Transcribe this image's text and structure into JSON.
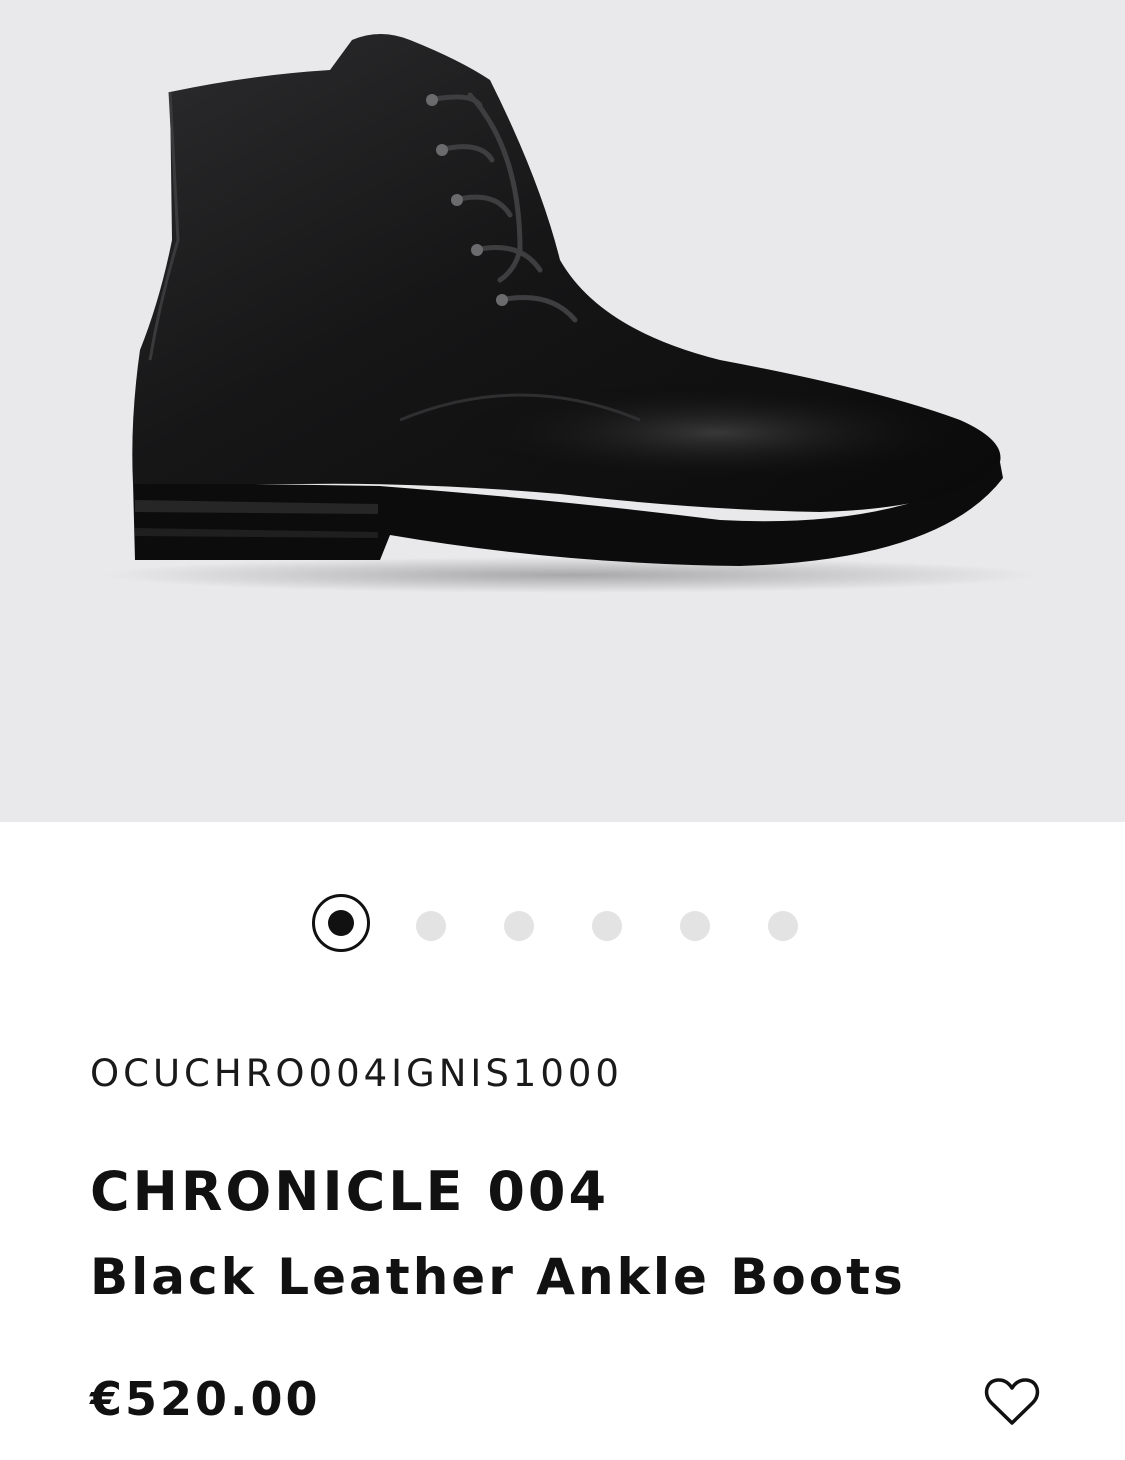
{
  "product": {
    "sku": "OCUCHRO004IGNIS1000",
    "name": "CHRONICLE 004",
    "description": "Black Leather Ankle Boots",
    "price": "€520.00",
    "image_icon": "boot-image"
  },
  "carousel": {
    "total": 6,
    "active_index": 0
  },
  "actions": {
    "wishlist_icon": "heart-icon"
  },
  "colors": {
    "hero_background": "#e9e9eb",
    "dot_inactive": "#e3e3e3",
    "dot_active": "#111111",
    "text": "#111111"
  }
}
